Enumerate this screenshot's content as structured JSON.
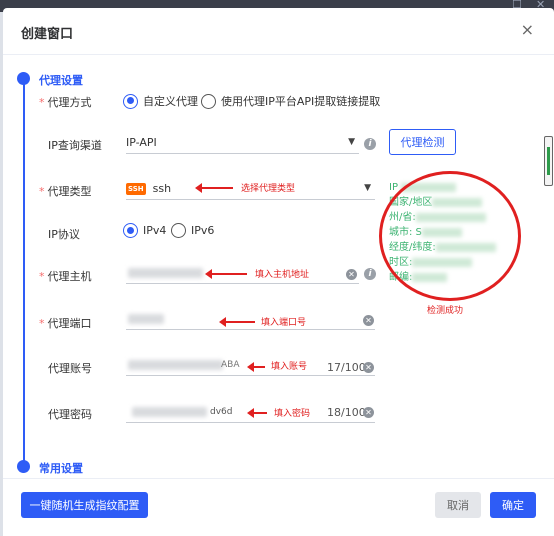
{
  "window": {
    "min_glyph": "_",
    "max_glyph": "☐",
    "close_glyph": "✕"
  },
  "dialog": {
    "title": "创建窗口",
    "close_glyph": "×"
  },
  "sections": {
    "proxy": "代理设置",
    "common": "常用设置"
  },
  "fields": {
    "proxy_mode": {
      "label": "代理方式",
      "required": true,
      "options": [
        {
          "label": "自定义代理",
          "selected": true
        },
        {
          "label": "使用代理IP平台API提取链接提取",
          "selected": false
        }
      ]
    },
    "ip_channel": {
      "label": "IP查询渠道",
      "value": "IP-API",
      "check_button": "代理检测"
    },
    "proxy_type": {
      "label": "代理类型",
      "required": true,
      "value": "ssh",
      "badge": "SSH"
    },
    "ip_protocol": {
      "label": "IP协议",
      "options": [
        {
          "label": "IPv4",
          "selected": true
        },
        {
          "label": "IPv6",
          "selected": false
        }
      ]
    },
    "host": {
      "label": "代理主机",
      "required": true
    },
    "port": {
      "label": "代理端口",
      "required": true
    },
    "account": {
      "label": "代理账号",
      "visible_fragment": "ABA",
      "counter": "17/100"
    },
    "password": {
      "label": "代理密码",
      "visible_fragment": "dv6d",
      "counter": "18/100"
    }
  },
  "annotations": {
    "type": "选择代理类型",
    "host": "填入主机地址",
    "port": "填入端口号",
    "account": "填入账号",
    "password": "填入密码",
    "success": "检测成功"
  },
  "detect_result": [
    "IP",
    "国家/地区",
    "州/省:",
    "城市: S",
    "经度/纬度:",
    "时区:",
    "邮编:"
  ],
  "footer": {
    "random_btn": "一键随机生成指纹配置",
    "cancel": "取消",
    "confirm": "确定"
  },
  "colors": {
    "primary": "#2e5cf6",
    "annotation": "#e02020",
    "success": "#3cb371"
  }
}
